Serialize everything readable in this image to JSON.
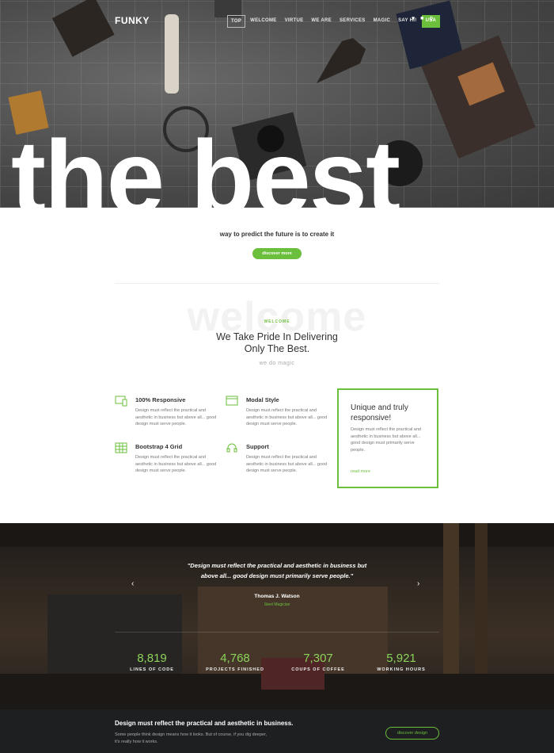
{
  "brand": "FUNKY",
  "nav": {
    "items": [
      "TOP",
      "WELCOME",
      "VIRTUE",
      "WE ARE",
      "SERVICES",
      "MAGIC",
      "SAY HI!"
    ],
    "active": "TOP",
    "cta": "USA"
  },
  "hero": {
    "headline": "the best",
    "tagline": "way to predict the future is to create it",
    "button": "discover more"
  },
  "welcome": {
    "ghost": "welcome",
    "kicker": "WELCOME",
    "headline_line1": "We Take Pride In Delivering",
    "headline_line2": "Only The Best.",
    "sub": "we do magic"
  },
  "features": [
    {
      "title": "100% Responsive",
      "text": "Design must reflect the practical and aesthetic in business but above all... good design must serve people.",
      "icon": "devices-icon"
    },
    {
      "title": "Modal Style",
      "text": "Design must reflect the practical and aesthetic in business but above all... good design must serve people.",
      "icon": "window-icon"
    },
    {
      "title": "Bootstrap 4 Grid",
      "text": "Design must reflect the practical and aesthetic in business but above all... good design must serve people.",
      "icon": "grid-icon"
    },
    {
      "title": "Support",
      "text": "Design must reflect the practical and aesthetic in business but above all... good design must serve people.",
      "icon": "headset-icon"
    }
  ],
  "highlight": {
    "title": "Unique and truly responsive!",
    "text": "Design must reflect the practical and aesthetic in business but above all... good design must primarily serve people.",
    "link": "read more"
  },
  "testimonial": {
    "quote_line1": "\"Design must reflect the practical and aesthetic in business but",
    "quote_line2": "above all... good design must primarily serve people.\"",
    "name": "Thomas J. Watson",
    "role": "Steel Magician"
  },
  "stats": [
    {
      "value": "8,819",
      "label": "LINES OF CODE"
    },
    {
      "value": "4,768",
      "label": "PROJECTS FINISHED"
    },
    {
      "value": "7,307",
      "label": "COUPS OF COFFEE"
    },
    {
      "value": "5,921",
      "label": "WORKING HOURS"
    }
  ],
  "cta": {
    "title": "Design must reflect the practical and aesthetic in business.",
    "text": "Some people think design means how it looks. But of course, if you dig deeper, it's really how it works.",
    "button": "discover design"
  },
  "colors": {
    "accent": "#6cbf3c",
    "dark": "#1e1f20"
  }
}
